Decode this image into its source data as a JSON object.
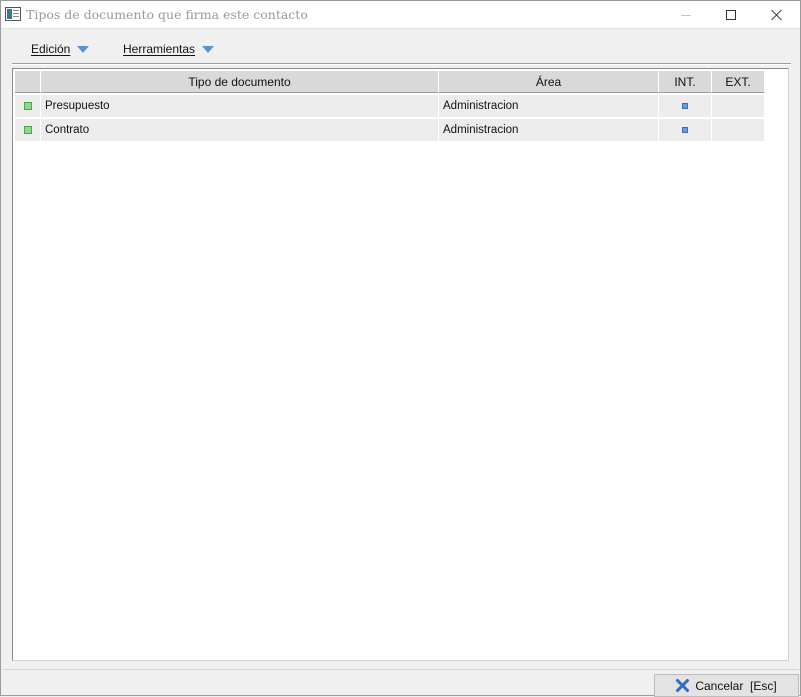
{
  "window": {
    "title": "Tipos de documento que firma este contacto"
  },
  "menu": {
    "edicion": "Edición",
    "herramientas": "Herramientas"
  },
  "grid": {
    "columns": [
      "Tipo de documento",
      "Área",
      "INT.",
      "EXT."
    ],
    "rows": [
      {
        "tipo": "Presupuesto",
        "area": "Administracion",
        "int": true,
        "ext": false
      },
      {
        "tipo": "Contrato",
        "area": "Administracion",
        "int": true,
        "ext": false
      }
    ]
  },
  "footer": {
    "cancel_label": "Cancelar  [Esc]"
  },
  "icons": {
    "app": "window-app-icon",
    "menu_arrow": "chevron-down-icon",
    "row_indicator": "green-square-icon",
    "int_marker": "blue-square-icon",
    "cancel": "close-x-icon"
  },
  "colors": {
    "accent_blue": "#5d8fd6",
    "indicator_green": "#8fd68f"
  }
}
